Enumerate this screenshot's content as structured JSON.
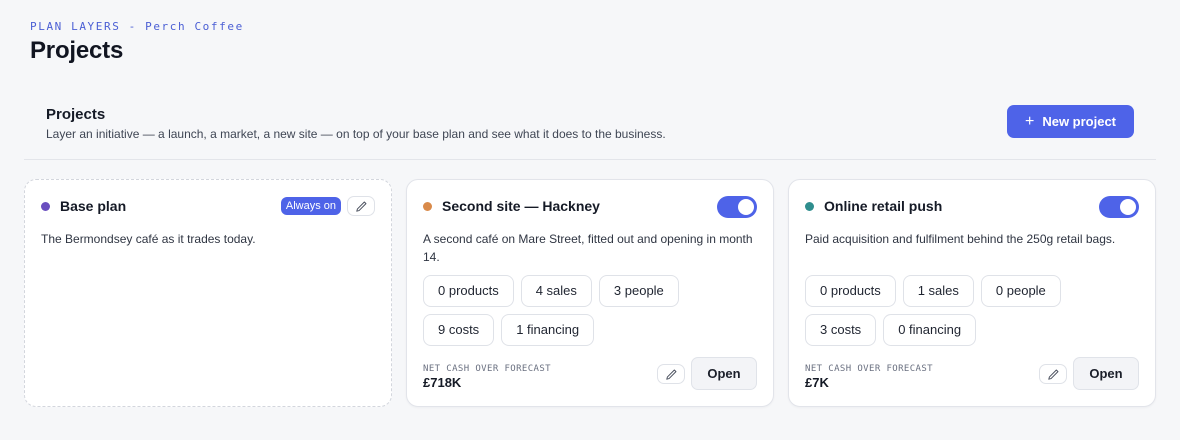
{
  "header": {
    "eyebrow": "PLAN LAYERS - Perch Coffee",
    "title": "Projects"
  },
  "section": {
    "title": "Projects",
    "subtitle": "Layer an initiative — a launch, a market, a new site — on top of your base plan and see what it does to the business.",
    "new_button_icon": "plus-icon",
    "new_button_label": "New project"
  },
  "colors": {
    "accent": "#4e63e8",
    "base_dot": "#6a4fbf",
    "hackney_dot": "#d98a4a",
    "online_dot": "#2f8e8e"
  },
  "base_plan": {
    "title": "Base plan",
    "badge": "Always on",
    "edit_icon": "pencil-icon",
    "description": "The Bermondsey café as it trades today."
  },
  "projects": [
    {
      "title": "Second site — Hackney",
      "enabled": true,
      "description": "A second café on Mare Street, fitted out and opening in month 14.",
      "chips": [
        "0 products",
        "4 sales",
        "3 people",
        "9 costs",
        "1 financing"
      ],
      "metric_label": "NET CASH OVER FORECAST",
      "metric_value": "£718K",
      "edit_icon": "pencil-icon",
      "open_label": "Open"
    },
    {
      "title": "Online retail push",
      "enabled": true,
      "description": "Paid acquisition and fulfilment behind the 250g retail bags.",
      "chips": [
        "0 products",
        "1 sales",
        "0 people",
        "3 costs",
        "0 financing"
      ],
      "metric_label": "NET CASH OVER FORECAST",
      "metric_value": "£7K",
      "edit_icon": "pencil-icon",
      "open_label": "Open"
    }
  ]
}
